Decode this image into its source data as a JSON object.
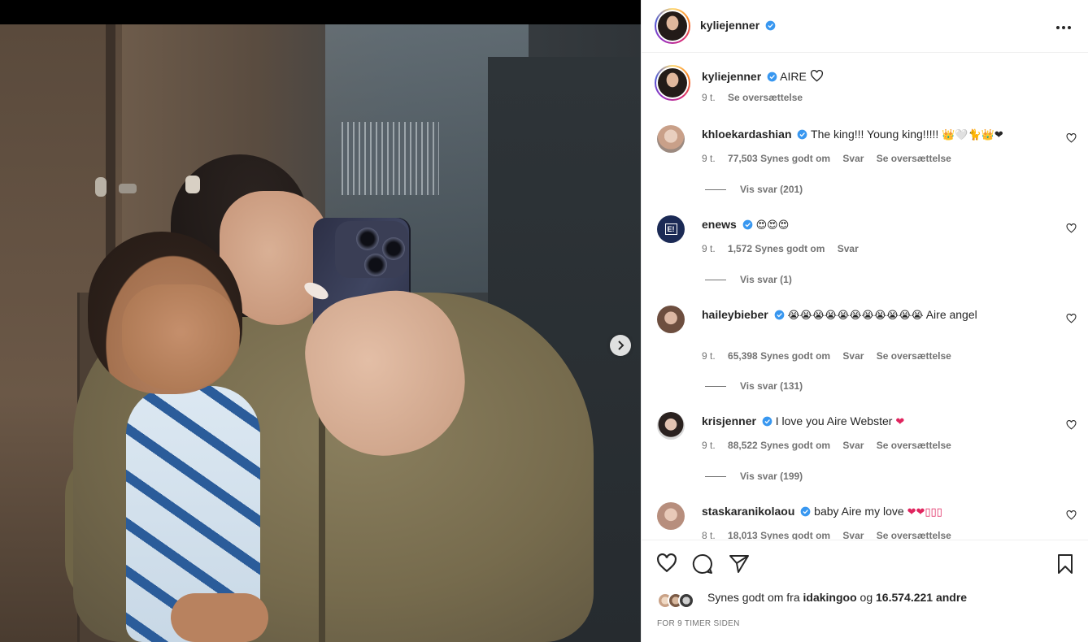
{
  "post": {
    "author": "kyliejenner",
    "caption_text": "AIRE"
  },
  "comments": [
    {
      "user": "kyliejenner",
      "text": "AIRE",
      "time": "9 t.",
      "likes": "",
      "reply": "",
      "translate": "Se oversættelse",
      "view_replies": ""
    },
    {
      "user": "khloekardashian",
      "text": "The king!!! Young king!!!!!",
      "emoji": "👑🤍🐈👑❤",
      "time": "9 t.",
      "likes": "77,503 Synes godt om",
      "reply": "Svar",
      "translate": "Se oversættelse",
      "view_replies": "Vis svar (201)"
    },
    {
      "user": "enews",
      "text": "",
      "emoji": "😍😍😍",
      "time": "9 t.",
      "likes": "1,572 Synes godt om",
      "reply": "Svar",
      "translate": "",
      "view_replies": "Vis svar (1)"
    },
    {
      "user": "haileybieber",
      "text": "Aire angel",
      "emoji": "😭😭😭😭😭😭😭😭😭😭😭",
      "time": "9 t.",
      "likes": "65,398 Synes godt om",
      "reply": "Svar",
      "translate": "Se oversættelse",
      "view_replies": "Vis svar (131)"
    },
    {
      "user": "krisjenner",
      "text": "I love you Aire Webster",
      "emoji": "❤",
      "time": "9 t.",
      "likes": "88,522 Synes godt om",
      "reply": "Svar",
      "translate": "Se oversættelse",
      "view_replies": "Vis svar (199)"
    },
    {
      "user": "staskaranikolaou",
      "text": "baby Aire my love",
      "emoji": "❤❤▯▯▯",
      "time": "8 t.",
      "likes": "18,013 Synes godt om",
      "reply": "Svar",
      "translate": "Se oversættelse",
      "view_replies": ""
    }
  ],
  "footer": {
    "liked_prefix": "Synes godt om fra",
    "liked_user": "idakingoo",
    "liked_and": "og",
    "liked_count": "16.574.221 andre",
    "timestamp": "FOR 9 TIMER SIDEN"
  },
  "icons": {
    "verified_color": "#3897f0",
    "heart_red": "#ed4956"
  }
}
